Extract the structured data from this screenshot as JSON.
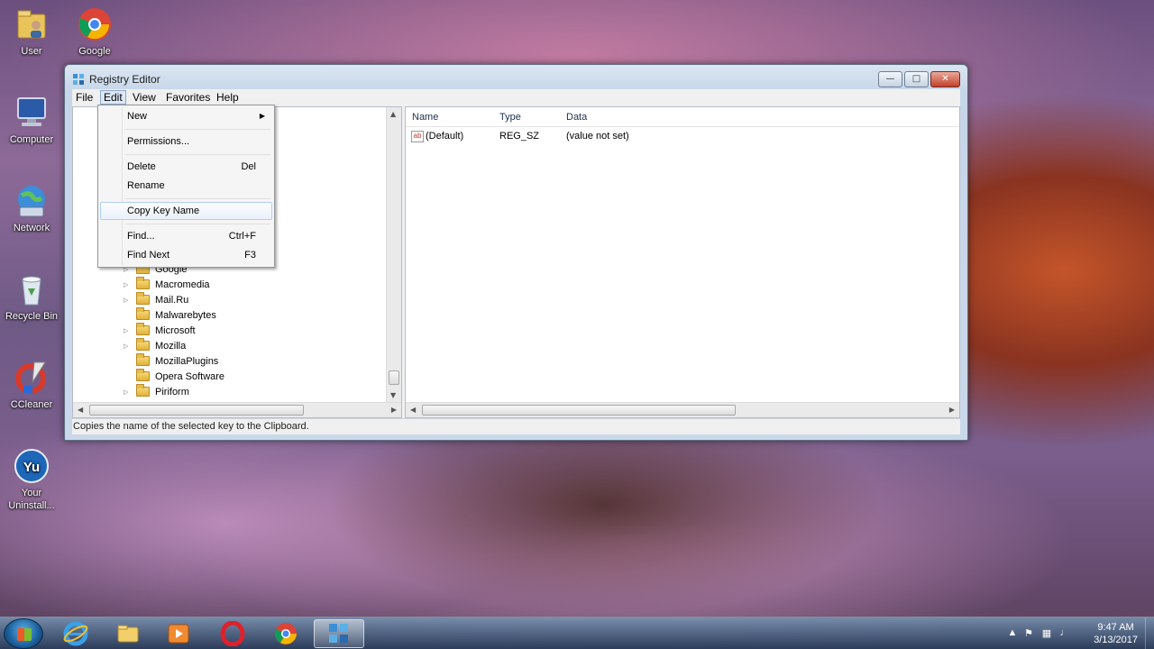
{
  "desktop": {
    "icons": [
      {
        "label": "User"
      },
      {
        "label": "Google"
      },
      {
        "label": "Computer"
      },
      {
        "label": "Network"
      },
      {
        "label": "Recycle Bin"
      },
      {
        "label": "CCleaner"
      },
      {
        "label": "Your Uninstall..."
      }
    ]
  },
  "window": {
    "title": "Registry Editor",
    "minimize": "—",
    "maximize": "□",
    "close": "✕"
  },
  "menubar": {
    "items": [
      "File",
      "Edit",
      "View",
      "Favorites",
      "Help"
    ],
    "active": "Edit"
  },
  "edit_menu": {
    "new": "New",
    "permissions": "Permissions...",
    "delete": "Delete",
    "delete_shortcut": "Del",
    "rename": "Rename",
    "copy_key_name": "Copy Key Name",
    "find": "Find...",
    "find_shortcut": "Ctrl+F",
    "find_next": "Find Next",
    "find_next_shortcut": "F3",
    "highlighted": "Copy Key Name"
  },
  "tree": {
    "items": [
      "Google",
      "Macromedia",
      "Mail.Ru",
      "Malwarebytes",
      "Microsoft",
      "Mozilla",
      "MozillaPlugins",
      "Opera Software",
      "Piriform"
    ]
  },
  "values_table": {
    "columns": [
      "Name",
      "Type",
      "Data"
    ],
    "rows": [
      {
        "name": "(Default)",
        "type": "REG_SZ",
        "data": "(value not set)"
      }
    ]
  },
  "statusbar": {
    "text": "Copies the name of the selected key to the Clipboard."
  },
  "taskbar": {
    "apps": [
      "internet-explorer",
      "file-explorer",
      "media-player",
      "opera",
      "chrome",
      "registry-editor"
    ],
    "active_app": "registry-editor"
  },
  "tray": {
    "time": "9:47 AM",
    "date": "3/13/2017"
  },
  "colors": {
    "accent": "#3a7bd5",
    "close_button": "#c2412b",
    "menu_highlight_border": "#aecff7"
  }
}
